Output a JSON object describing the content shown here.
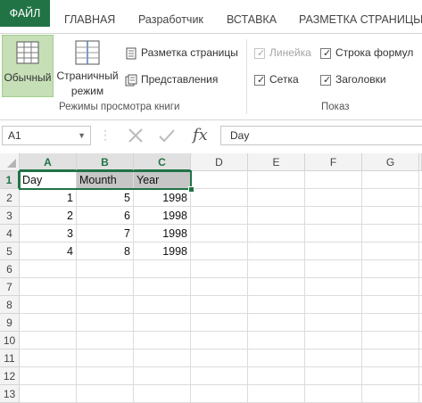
{
  "ribbon": {
    "tabs": [
      "ФАЙЛ",
      "ГЛАВНАЯ",
      "Разработчик",
      "ВСТАВКА",
      "РАЗМЕТКА СТРАНИЦЫ"
    ],
    "views": {
      "normal_label": "Обычный",
      "page_label_1": "Страничный",
      "page_label_2": "режим",
      "page_layout_label": "Разметка страницы",
      "custom_views_label": "Представления",
      "group_label": "Режимы просмотра книги"
    },
    "show": {
      "ruler_label": "Линейка",
      "formula_bar_label": "Строка формул",
      "gridlines_label": "Сетка",
      "headings_label": "Заголовки",
      "group_label": "Показ"
    }
  },
  "formula_bar": {
    "name_box": "A1",
    "fx_label": "fx",
    "content": "Day"
  },
  "sheet": {
    "columns": [
      "A",
      "B",
      "C",
      "D",
      "E",
      "F",
      "G"
    ],
    "rows": [
      "1",
      "2",
      "3",
      "4",
      "5",
      "6",
      "7",
      "8",
      "9",
      "10",
      "11",
      "12",
      "13"
    ],
    "headers": [
      "Day",
      "Mounth",
      "Year"
    ],
    "data": [
      [
        "1",
        "5",
        "1998"
      ],
      [
        "2",
        "6",
        "1998"
      ],
      [
        "3",
        "7",
        "1998"
      ],
      [
        "4",
        "8",
        "1998"
      ]
    ]
  },
  "colors": {
    "accent": "#217346",
    "selection_fill": "#c6dfb7",
    "header_fill": "#c6c6c6"
  }
}
